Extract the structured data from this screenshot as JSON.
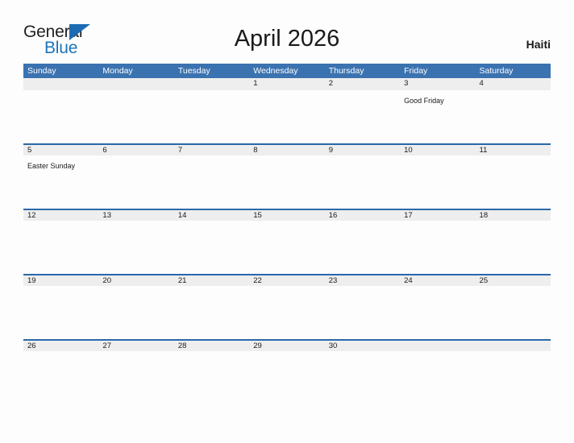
{
  "brand": {
    "name_part1": "General",
    "name_part2": "Blue",
    "triangle_color": "#1d6cb3",
    "blue_text_color": "#1b75bb"
  },
  "header": {
    "title": "April 2026",
    "country": "Haiti"
  },
  "colors": {
    "weekday_header_bg": "#3b72b0",
    "daybar_bg": "#eeeeee",
    "daybar_top_border": "#2a68a8",
    "page_bg": "#fdfdfd",
    "text": "#1a1a1a",
    "weekday_text": "#ffffff"
  },
  "calendar": {
    "weekdays": [
      "Sunday",
      "Monday",
      "Tuesday",
      "Wednesday",
      "Thursday",
      "Friday",
      "Saturday"
    ],
    "weeks": [
      {
        "days": [
          {
            "number": "",
            "event": ""
          },
          {
            "number": "",
            "event": ""
          },
          {
            "number": "",
            "event": ""
          },
          {
            "number": "1",
            "event": ""
          },
          {
            "number": "2",
            "event": ""
          },
          {
            "number": "3",
            "event": "Good Friday"
          },
          {
            "number": "4",
            "event": ""
          }
        ]
      },
      {
        "days": [
          {
            "number": "5",
            "event": "Easter Sunday"
          },
          {
            "number": "6",
            "event": ""
          },
          {
            "number": "7",
            "event": ""
          },
          {
            "number": "8",
            "event": ""
          },
          {
            "number": "9",
            "event": ""
          },
          {
            "number": "10",
            "event": ""
          },
          {
            "number": "11",
            "event": ""
          }
        ]
      },
      {
        "days": [
          {
            "number": "12",
            "event": ""
          },
          {
            "number": "13",
            "event": ""
          },
          {
            "number": "14",
            "event": ""
          },
          {
            "number": "15",
            "event": ""
          },
          {
            "number": "16",
            "event": ""
          },
          {
            "number": "17",
            "event": ""
          },
          {
            "number": "18",
            "event": ""
          }
        ]
      },
      {
        "days": [
          {
            "number": "19",
            "event": ""
          },
          {
            "number": "20",
            "event": ""
          },
          {
            "number": "21",
            "event": ""
          },
          {
            "number": "22",
            "event": ""
          },
          {
            "number": "23",
            "event": ""
          },
          {
            "number": "24",
            "event": ""
          },
          {
            "number": "25",
            "event": ""
          }
        ]
      },
      {
        "days": [
          {
            "number": "26",
            "event": ""
          },
          {
            "number": "27",
            "event": ""
          },
          {
            "number": "28",
            "event": ""
          },
          {
            "number": "29",
            "event": ""
          },
          {
            "number": "30",
            "event": ""
          },
          {
            "number": "",
            "event": ""
          },
          {
            "number": "",
            "event": ""
          }
        ]
      }
    ]
  }
}
